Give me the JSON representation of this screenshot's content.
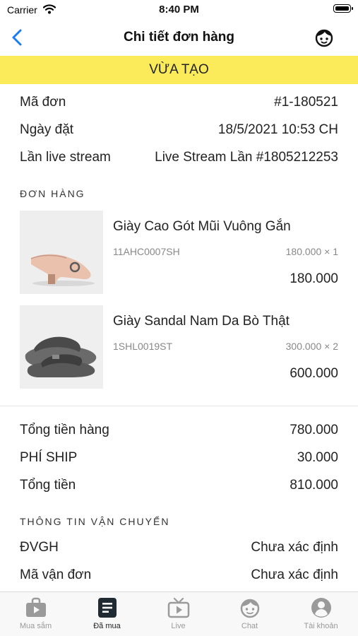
{
  "status_bar": {
    "carrier": "Carrier",
    "time": "8:40 PM"
  },
  "nav": {
    "title": "Chi tiết đơn hàng"
  },
  "status_banner": {
    "label": "VỪA TẠO",
    "color": "#fbeb5b"
  },
  "order": {
    "code_label": "Mã đơn",
    "code_value": "#1-180521",
    "date_label": "Ngày đặt",
    "date_value": "18/5/2021 10:53 CH",
    "live_label": "Lần live stream",
    "live_value": "Live Stream Lần #1805212253"
  },
  "items_section": "ĐƠN HÀNG",
  "items": [
    {
      "name": "Giày Cao Gót Mũi Vuông Gắn",
      "sku": "11AHC0007SH",
      "qty": "180.000 × 1",
      "subtotal": "180.000"
    },
    {
      "name": "Giày Sandal Nam Da Bò Thật",
      "sku": "1SHL0019ST",
      "qty": "300.000 × 2",
      "subtotal": "600.000"
    }
  ],
  "totals": {
    "goods_label": "Tổng tiền hàng",
    "goods_value": "780.000",
    "ship_label": "PHÍ SHIP",
    "ship_value": "30.000",
    "total_label": "Tổng tiền",
    "total_value": "810.000"
  },
  "shipping_section": "THÔNG TIN VẬN CHUYỂN",
  "shipping": {
    "carrier_label": "ĐVGH",
    "carrier_value": "Chưa xác định",
    "tracking_label": "Mã vận đơn",
    "tracking_value": "Chưa xác định"
  },
  "tabs": [
    {
      "label": "Mua sắm",
      "icon": "shopping-bag-icon"
    },
    {
      "label": "Đã mua",
      "icon": "orders-icon"
    },
    {
      "label": "Live",
      "icon": "tv-icon"
    },
    {
      "label": "Chat",
      "icon": "chat-face-icon"
    },
    {
      "label": "Tài khoản",
      "icon": "account-icon"
    }
  ]
}
